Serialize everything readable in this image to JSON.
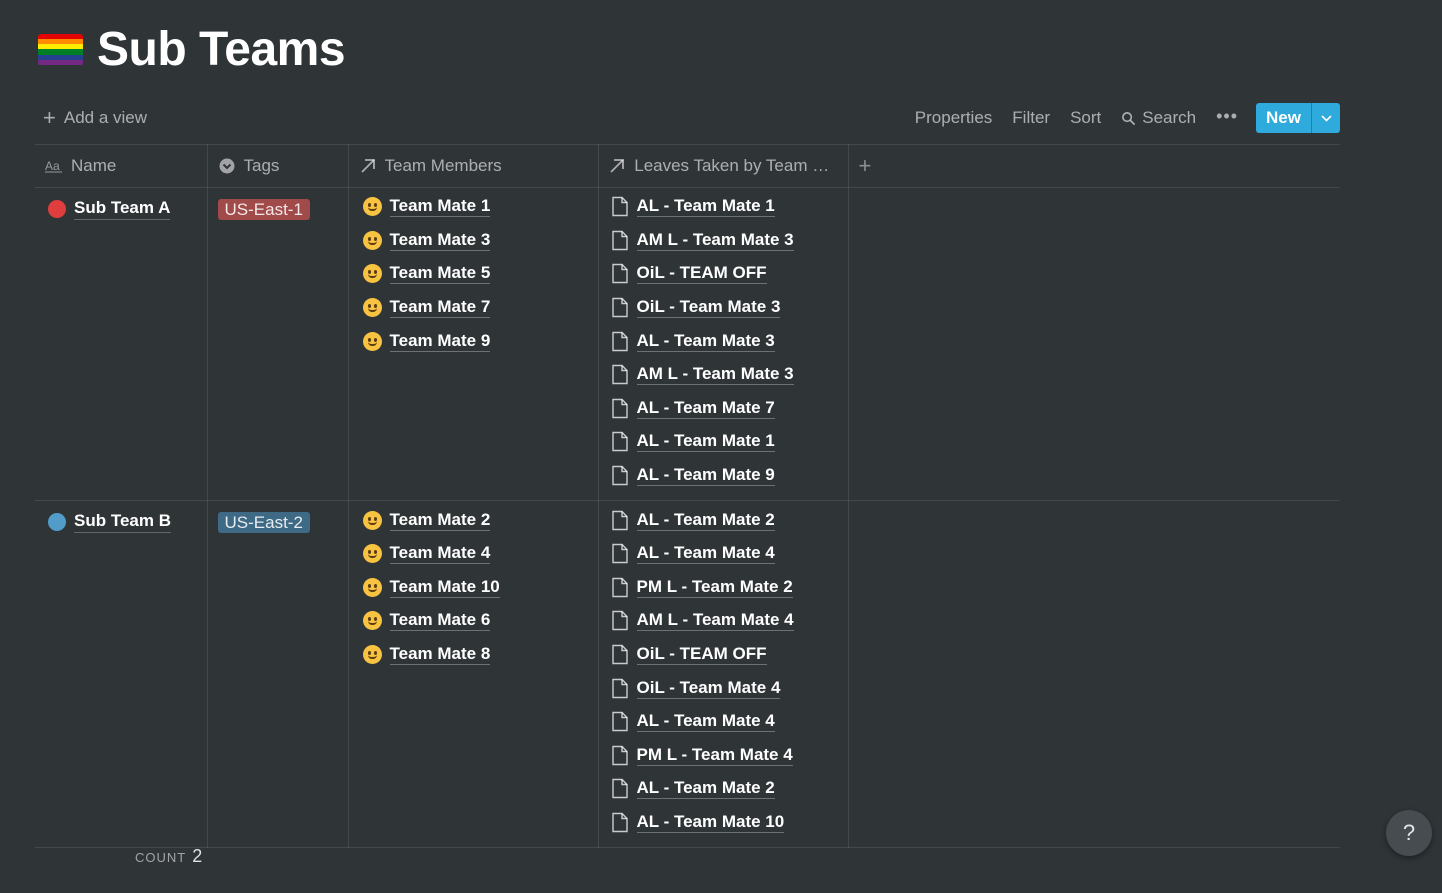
{
  "page": {
    "title": "Sub Teams",
    "icon": "rainbow-flag-icon",
    "flag_colors": [
      "#e40303",
      "#ff8c00",
      "#ffed00",
      "#008026",
      "#24408e",
      "#732982"
    ]
  },
  "toolbar": {
    "add_view_label": "Add a view",
    "properties_label": "Properties",
    "filter_label": "Filter",
    "sort_label": "Sort",
    "search_label": "Search",
    "more_label": "•••",
    "new_label": "New",
    "accent_color": "#2eaadc"
  },
  "columns": [
    {
      "label": "Name",
      "icon": "text-aa-icon"
    },
    {
      "label": "Tags",
      "icon": "select-icon"
    },
    {
      "label": "Team Members",
      "icon": "relation-arrow-icon"
    },
    {
      "label": "Leaves Taken by Team M...",
      "icon": "relation-arrow-icon"
    }
  ],
  "add_column_label": "+",
  "rows": [
    {
      "name": "Sub Team A",
      "dot_color": "#e03e3e",
      "tag": "US-East-1",
      "tag_color": "#a04a49",
      "members": [
        "Team Mate 1",
        "Team Mate 3",
        "Team Mate 5",
        "Team Mate 7",
        "Team Mate 9"
      ],
      "leaves": [
        "AL - Team Mate 1",
        "AM L - Team Mate 3",
        "OiL - TEAM OFF",
        "OiL - Team Mate 3",
        "AL - Team Mate 3",
        "AM L - Team Mate 3",
        "AL - Team Mate 7",
        "AL - Team Mate 1",
        "AL - Team Mate 9"
      ]
    },
    {
      "name": "Sub Team B",
      "dot_color": "#529cca",
      "tag": "US-East-2",
      "tag_color": "#3f6a85",
      "members": [
        "Team Mate 2",
        "Team Mate 4",
        "Team Mate 10",
        "Team Mate 6",
        "Team Mate 8"
      ],
      "leaves": [
        "AL - Team Mate 2",
        "AL - Team Mate 4",
        "PM L - Team Mate 2",
        "AM L - Team Mate 4",
        "OiL - TEAM OFF",
        "OiL - Team Mate 4",
        "AL - Team Mate 4",
        "PM L - Team Mate 4",
        "AL - Team Mate 2",
        "AL - Team Mate 10"
      ]
    }
  ],
  "footer": {
    "count_label": "COUNT",
    "count_value": "2"
  },
  "help_label": "?"
}
